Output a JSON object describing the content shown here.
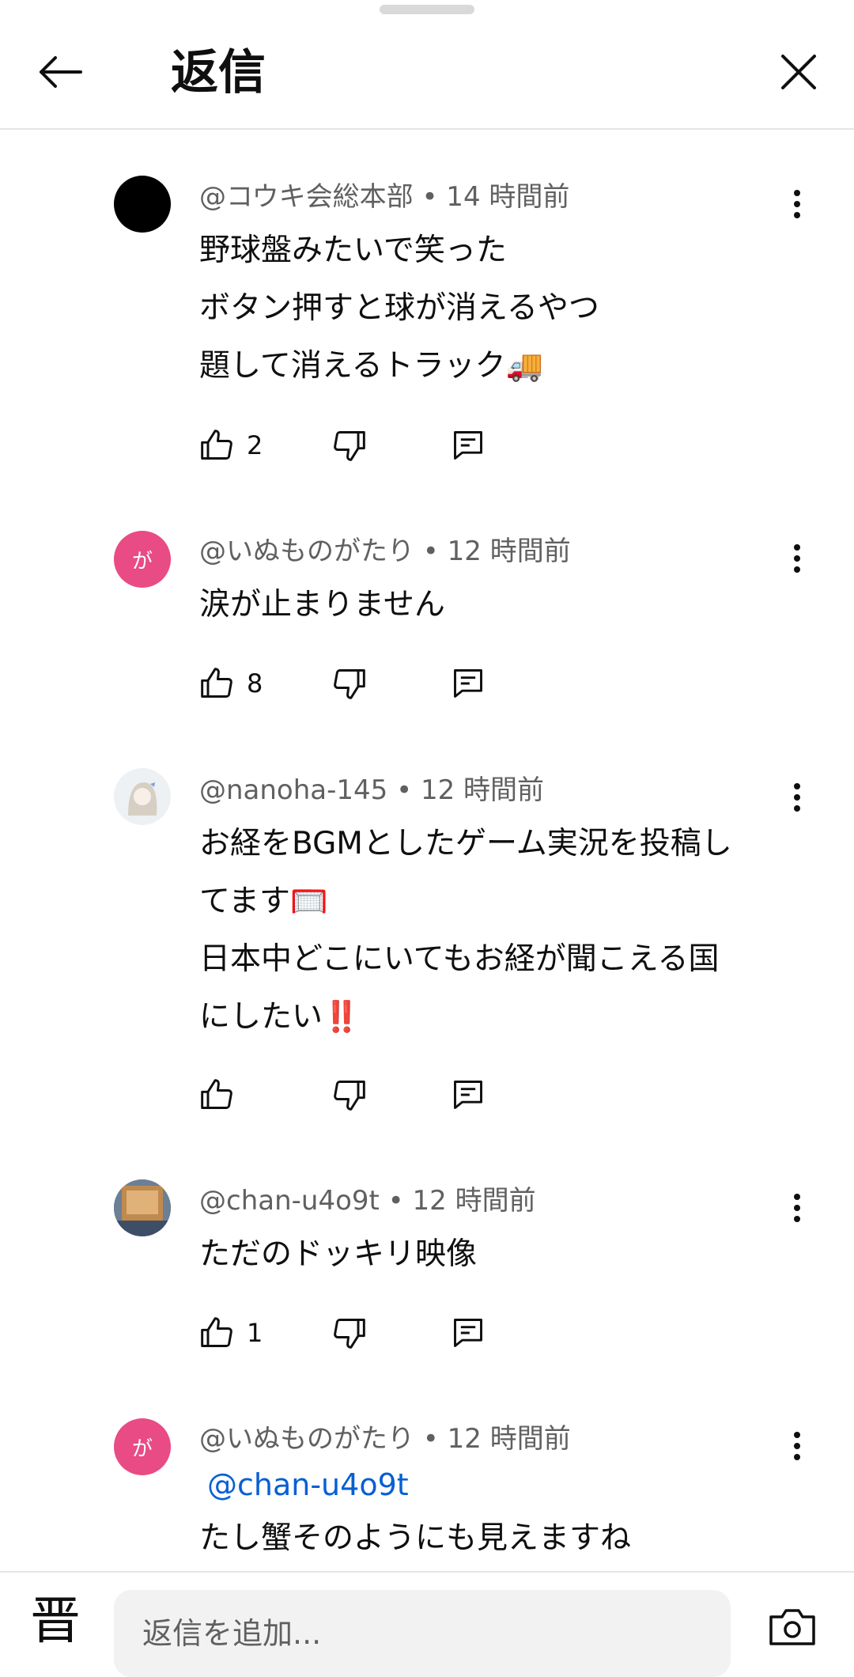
{
  "header": {
    "title": "返信"
  },
  "comments": [
    {
      "meta": "@コウキ会総本部 • 14 時間前",
      "lines": [
        "野球盤みたいで笑った",
        "ボタン押すと球が消えるやつ",
        "題して消えるトラック"
      ],
      "emoji": "🚚",
      "likes": "2",
      "avatar_color": "#000000"
    },
    {
      "meta": "@いぬものがたり • 12 時間前",
      "lines": [
        "涙が止まりません"
      ],
      "likes": "8",
      "avatar_letter": "が",
      "avatar_color": "#e94b84"
    },
    {
      "meta": "@nanoha-145 • 12 時間前",
      "lines": [
        "お経をBGMとしたゲーム実況を投稿し",
        "てます",
        "日本中どこにいてもお経が聞こえる国",
        "にしたい"
      ],
      "emoji1": "🥅",
      "emoji2": "‼️",
      "likes": ""
    },
    {
      "meta": "@chan-u4o9t • 12 時間前",
      "lines": [
        "ただのドッキリ映像"
      ],
      "likes": "1"
    },
    {
      "meta": "@いぬものがたり • 12 時間前",
      "mention": "@chan-u4o9t",
      "lines": [
        "たし蟹そのようにも見えますね"
      ],
      "avatar_letter": "が",
      "avatar_color": "#e94b84"
    }
  ],
  "footer": {
    "user_glyph": "晋",
    "input_placeholder": "返信を追加..."
  },
  "colors": {
    "meta": "#606060",
    "mention": "#065fd4",
    "divider": "#e5e5e5"
  }
}
